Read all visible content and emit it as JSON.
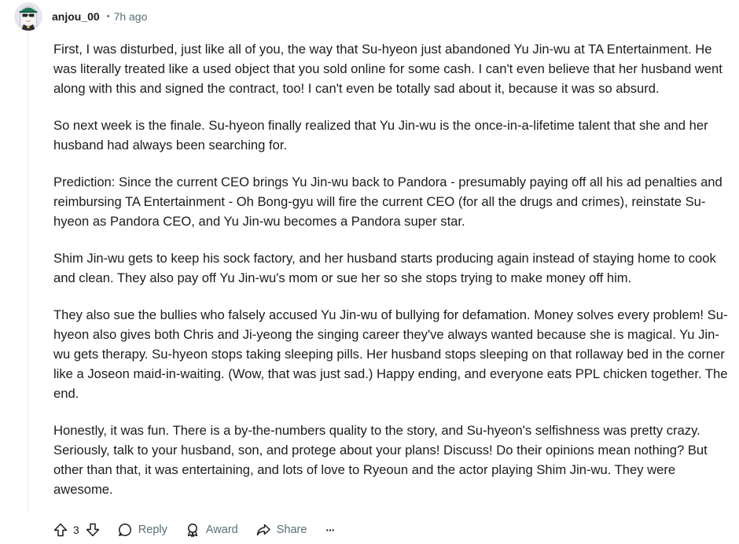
{
  "comment": {
    "author": "anjou_00",
    "separator": "•",
    "time": "7h ago",
    "paragraphs": [
      "First, I was disturbed, just like all of you, the way that Su-hyeon just abandoned Yu Jin-wu at TA Entertainment. He was literally treated like a used object that you sold online for some cash. I can't even believe that her husband went along with this and signed the contract, too! I can't even be totally sad about it, because it was so absurd.",
      "So next week is the finale. Su-hyeon finally realized that Yu Jin-wu is the once-in-a-lifetime talent that she and her husband had always been searching for.",
      "Prediction: Since the current CEO brings Yu Jin-wu back to Pandora - presumably paying off all his ad penalties and reimbursing TA Entertainment - Oh Bong-gyu will fire the current CEO (for all the drugs and crimes), reinstate Su-hyeon as Pandora CEO, and Yu Jin-wu becomes a Pandora super star.",
      "Shim Jin-wu gets to keep his sock factory, and her husband starts producing again instead of staying home to cook and clean. They also pay off Yu Jin-wu's mom or sue her so she stops trying to make money off him.",
      "They also sue the bullies who falsely accused Yu Jin-wu of bullying for defamation. Money solves every problem! Su-hyeon also gives both Chris and Ji-yeong the singing career they've always wanted because she is magical. Yu Jin-wu gets therapy. Su-hyeon stops taking sleeping pills. Her husband stops sleeping on that rollaway bed in the corner like a Joseon maid-in-waiting. (Wow, that was just sad.) Happy ending, and everyone eats PPL chicken together. The end.",
      "Honestly, it was fun. There is a by-the-numbers quality to the story, and Su-hyeon's selfishness was pretty crazy. Seriously, talk to your husband, son, and protege about your plans! Discuss! Do their opinions mean nothing? But other than that, it was entertaining, and lots of love to Ryeoun and the actor playing Shim Jin-wu. They were awesome."
    ]
  },
  "actions": {
    "score": "3",
    "reply_label": "Reply",
    "award_label": "Award",
    "share_label": "Share",
    "more_label": "···"
  },
  "icons": {
    "avatar": "avatar-image",
    "upvote": "upvote-arrow-icon",
    "downvote": "downvote-arrow-icon",
    "reply": "speech-bubble-icon",
    "award": "award-icon",
    "share": "share-arrow-icon",
    "more": "ellipsis-icon"
  },
  "colors": {
    "text": "#1c1c1c",
    "meta": "#576f76",
    "time": "#576f76",
    "thread_line": "#e5ebee"
  }
}
